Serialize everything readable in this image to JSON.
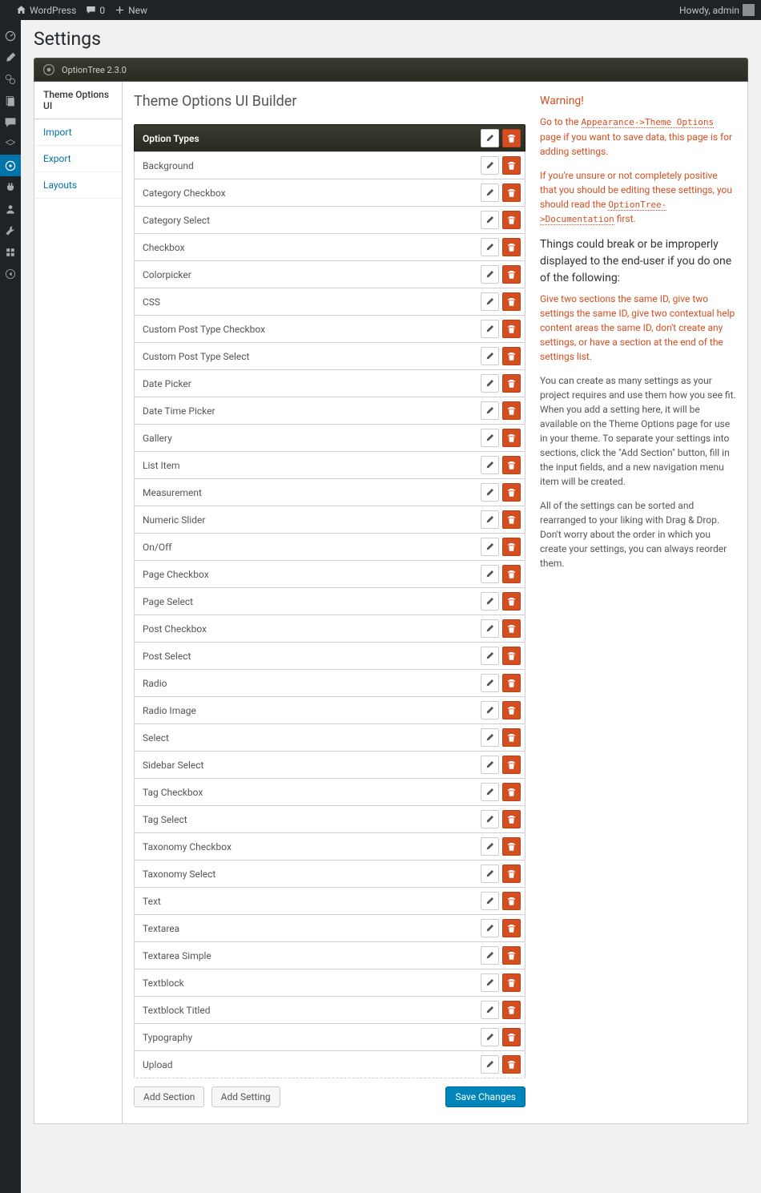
{
  "adminbar": {
    "site": "WordPress",
    "comments": "0",
    "new": "New",
    "howdy": "Howdy, admin"
  },
  "page": {
    "title": "Settings"
  },
  "ot": {
    "version": "OptionTree 2.3.0",
    "tabs": [
      "Theme Options UI",
      "Import",
      "Export",
      "Layouts"
    ],
    "main_title": "Theme Options UI Builder",
    "section_head": "Option Types",
    "options": [
      "Background",
      "Category Checkbox",
      "Category Select",
      "Checkbox",
      "Colorpicker",
      "CSS",
      "Custom Post Type Checkbox",
      "Custom Post Type Select",
      "Date Picker",
      "Date Time Picker",
      "Gallery",
      "List Item",
      "Measurement",
      "Numeric Slider",
      "On/Off",
      "Page Checkbox",
      "Page Select",
      "Post Checkbox",
      "Post Select",
      "Radio",
      "Radio Image",
      "Select",
      "Sidebar Select",
      "Tag Checkbox",
      "Tag Select",
      "Taxonomy Checkbox",
      "Taxonomy Select",
      "Text",
      "Textarea",
      "Textarea Simple",
      "Textblock",
      "Textblock Titled",
      "Typography",
      "Upload"
    ],
    "bottom": {
      "add_section": "Add Section",
      "add_setting": "Add Setting",
      "save": "Save Changes"
    }
  },
  "side": {
    "warn_head": "Warning!",
    "warn1a": "Go to the ",
    "warn1link": "Appearance->Theme Options",
    "warn1b": " page if you want to save data, this page is for adding settings.",
    "warn2a": "If you're unsure or not completely positive that you should be editing these settings, you should read the ",
    "warn2link": "OptionTree->Documentation",
    "warn2b": " first.",
    "break_head": "Things could break or be improperly displayed to the end-user if you do one of the following:",
    "break_body": "Give two sections the same ID, give two settings the same ID, give two contextual help content areas the same ID, don't create any settings, or have a section at the end of the settings list.",
    "info1": "You can create as many settings as your project requires and use them how you see fit. When you add a setting here, it will be available on the Theme Options page for use in your theme. To separate your settings into sections, click the \"Add Section\" button, fill in the input fields, and a new navigation menu item will be created.",
    "info2": "All of the settings can be sorted and rearranged to your liking with Drag & Drop. Don't worry about the order in which you create your settings, you can always reorder them."
  }
}
